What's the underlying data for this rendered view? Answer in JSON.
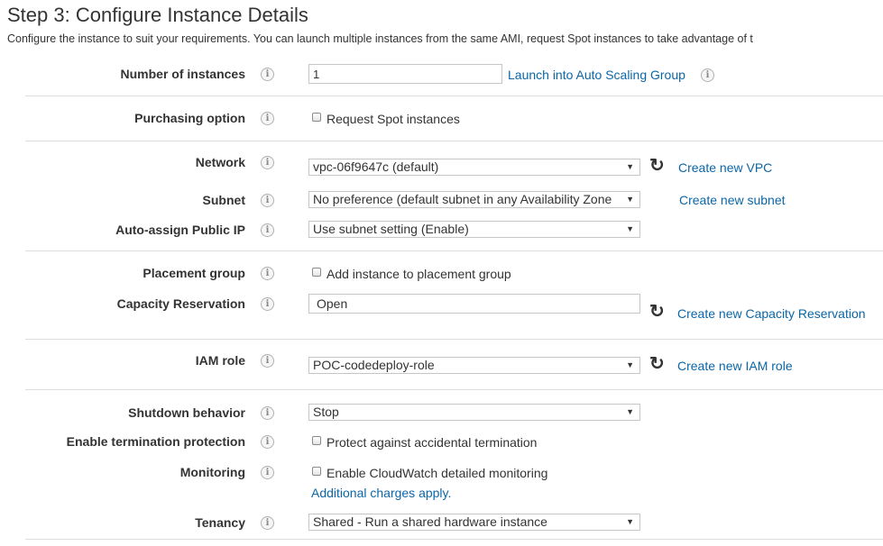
{
  "header": {
    "title": "Step 3: Configure Instance Details",
    "subtitle": "Configure the instance to suit your requirements. You can launch multiple instances from the same AMI, request Spot instances to take advantage of t"
  },
  "info_icon": "i",
  "refresh_icon": "↻",
  "dropdown_arrow": "▼",
  "fields": {
    "number_of_instances": {
      "label": "Number of instances",
      "value": "1",
      "link": "Launch into Auto Scaling Group"
    },
    "purchasing_option": {
      "label": "Purchasing option",
      "checkbox_label": "Request Spot instances"
    },
    "network": {
      "label": "Network",
      "value": "vpc-06f9647c (default)",
      "link": "Create new VPC"
    },
    "subnet": {
      "label": "Subnet",
      "value": "No preference (default subnet in any Availability Zonе",
      "link": "Create new subnet"
    },
    "auto_assign_ip": {
      "label": "Auto-assign Public IP",
      "value": "Use subnet setting (Enable)"
    },
    "placement_group": {
      "label": "Placement group",
      "checkbox_label": "Add instance to placement group"
    },
    "capacity_reservation": {
      "label": "Capacity Reservation",
      "value": "Open",
      "link": "Create new Capacity Reservation"
    },
    "iam_role": {
      "label": "IAM role",
      "value": "POC-codedeploy-role",
      "link": "Create new IAM role"
    },
    "shutdown_behavior": {
      "label": "Shutdown behavior",
      "value": "Stop"
    },
    "termination_protection": {
      "label": "Enable termination protection",
      "checkbox_label": "Protect against accidental termination"
    },
    "monitoring": {
      "label": "Monitoring",
      "checkbox_label": "Enable CloudWatch detailed monitoring",
      "note_link": "Additional charges apply."
    },
    "tenancy": {
      "label": "Tenancy",
      "value": "Shared - Run a shared hardware instance"
    }
  },
  "colors": {
    "link": "#0b66a8",
    "text": "#333333",
    "border": "#c6c6c6",
    "separator": "#dddddd"
  }
}
